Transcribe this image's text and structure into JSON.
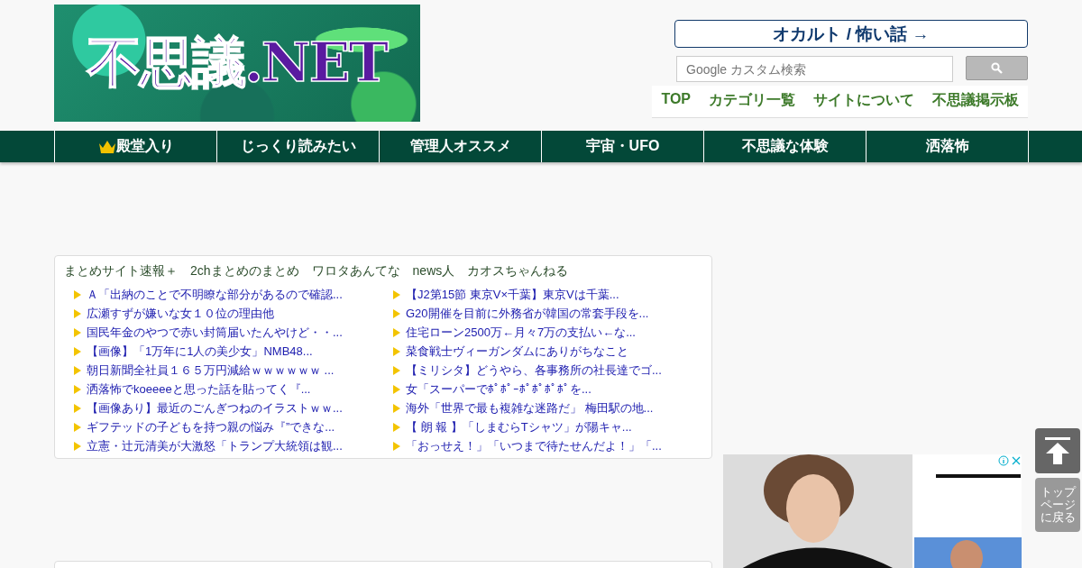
{
  "logo": {
    "text": "不思議.NET"
  },
  "header": {
    "feature_link": "オカルト / 怖い話 →",
    "search": {
      "placeholder": "Google カスタム検索"
    },
    "links": [
      "TOP",
      "カテゴリ一覧",
      "サイトについて",
      "不思議掲示板"
    ]
  },
  "nav": [
    {
      "label": "殿堂入り",
      "crown": true
    },
    {
      "label": "じっくり読みたい",
      "crown": false
    },
    {
      "label": "管理人オススメ",
      "crown": false
    },
    {
      "label": "宇宙・UFO",
      "crown": false
    },
    {
      "label": "不思議な体験",
      "crown": false
    },
    {
      "label": "洒落怖",
      "crown": false
    }
  ],
  "feed": {
    "sites": [
      "まとめサイト速報＋",
      "2chまとめのまとめ",
      "ワロタあんてな",
      "news人",
      "カオスちゃんねる"
    ],
    "columns": [
      [
        "Ａ「出納のことで不明瞭な部分があるので確認...",
        "広瀬すずが嫌いな女１０位の理由他",
        "国民年金のやつで赤い封筒届いたんやけど・・...",
        "【画像】「1万年に1人の美少女」NMB48...",
        "朝日新聞全社員１６５万円減給ｗｗｗｗｗｗ ...",
        "洒落怖でkoeeeeと思った話を貼ってく『...",
        "【画像あり】最近のごんぎつねのイラストｗｗ...",
        "ギフテッドの子どもを持つ親の悩み『”できな...",
        "立憲・辻元清美が大激怒「トランプ大統領は観..."
      ],
      [
        "【J2第15節 東京V×千葉】東京Vは千葉...",
        "G20開催を目前に外務省が韓国の常套手段を...",
        "住宅ローン2500万←月々7万の支払い←な...",
        "菜食戦士ヴィーガンダムにありがちなこと",
        "【ミリシタ】どうやら、各事務所の社長達でゴ...",
        "女「スーパーでﾎﾟﾎﾟｰﾎﾟﾎﾟﾎﾟﾎﾟを...",
        "海外「世界で最も複雑な迷路だ」 梅田駅の地...",
        "【 朗 報 】「しまむらTシャツ」が陽キャ...",
        "「おっせえ！」「いつまで待たせんだよ！」「..."
      ]
    ]
  },
  "back_to_top": {
    "label": "トップページに戻る"
  }
}
